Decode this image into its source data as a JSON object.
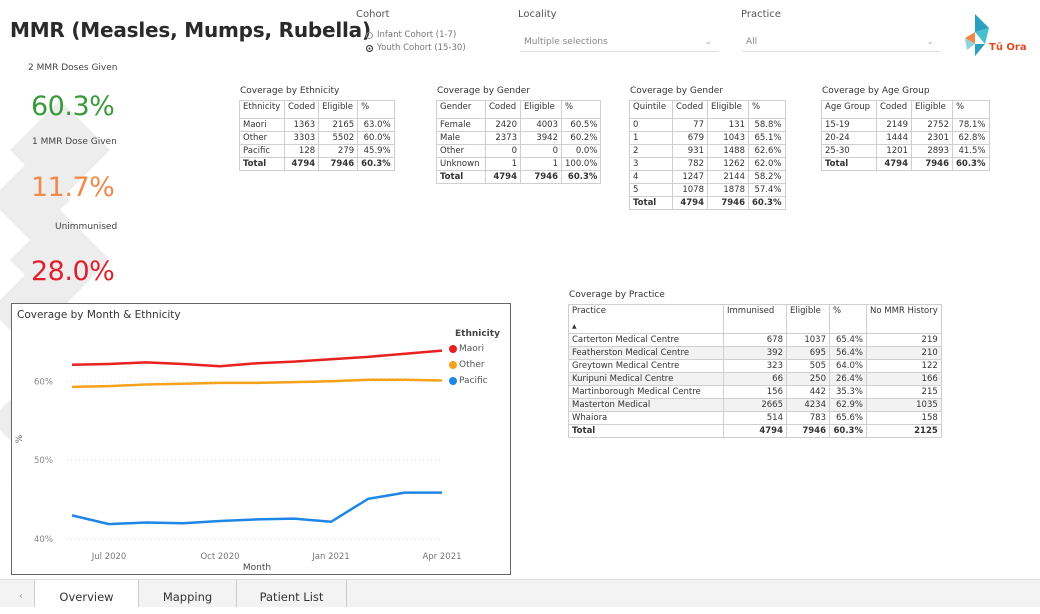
{
  "title": "MMR (Measles, Mumps, Rubella)",
  "kpis": [
    {
      "label": "2 MMR Doses Given",
      "value": "60.3%",
      "color": "#3a9a3a"
    },
    {
      "label": "1 MMR Dose Given",
      "value": "11.7%",
      "color": "#f08a4b"
    },
    {
      "label": "Unimmunised",
      "value": "28.0%",
      "color": "#e0202e"
    }
  ],
  "cohort": {
    "title": "Cohort",
    "options": [
      {
        "label": "Infant Cohort (1-7)",
        "selected": false
      },
      {
        "label": "Youth Cohort (15-30)",
        "selected": true
      }
    ]
  },
  "locality": {
    "title": "Locality",
    "value": "Multiple selections"
  },
  "practice": {
    "title": "Practice",
    "value": "All"
  },
  "logo": {
    "text": "Tū Ora",
    "icon": "tu-ora-logo-icon"
  },
  "ethnicity_table": {
    "title": "Coverage by Ethnicity",
    "headers": [
      "Ethnicity",
      "Coded",
      "Eligible",
      "%"
    ],
    "rows": [
      [
        "Maori",
        "1363",
        "2165",
        "63.0%"
      ],
      [
        "Other",
        "3303",
        "5502",
        "60.0%"
      ],
      [
        "Pacific",
        "128",
        "279",
        "45.9%"
      ]
    ],
    "total": [
      "Total",
      "4794",
      "7946",
      "60.3%"
    ]
  },
  "gender_table": {
    "title": "Coverage by Gender",
    "headers": [
      "Gender",
      "Coded",
      "Eligible",
      "%"
    ],
    "rows": [
      [
        "Female",
        "2420",
        "4003",
        "60.5%"
      ],
      [
        "Male",
        "2373",
        "3942",
        "60.2%"
      ],
      [
        "Other",
        "0",
        "0",
        "0.0%"
      ],
      [
        "Unknown",
        "1",
        "1",
        "100.0%"
      ]
    ],
    "total": [
      "Total",
      "4794",
      "7946",
      "60.3%"
    ]
  },
  "quintile_table": {
    "title": "Coverage by Gender",
    "headers": [
      "Quintile",
      "Coded",
      "Eligible",
      "%"
    ],
    "rows": [
      [
        "0",
        "77",
        "131",
        "58.8%"
      ],
      [
        "1",
        "679",
        "1043",
        "65.1%"
      ],
      [
        "2",
        "931",
        "1488",
        "62.6%"
      ],
      [
        "3",
        "782",
        "1262",
        "62.0%"
      ],
      [
        "4",
        "1247",
        "2144",
        "58.2%"
      ],
      [
        "5",
        "1078",
        "1878",
        "57.4%"
      ]
    ],
    "total": [
      "Total",
      "4794",
      "7946",
      "60.3%"
    ]
  },
  "age_table": {
    "title": "Coverage by Age Group",
    "headers": [
      "Age Group",
      "Coded",
      "Eligible",
      "%"
    ],
    "rows": [
      [
        "15-19",
        "2149",
        "2752",
        "78.1%"
      ],
      [
        "20-24",
        "1444",
        "2301",
        "62.8%"
      ],
      [
        "25-30",
        "1201",
        "2893",
        "41.5%"
      ]
    ],
    "total": [
      "Total",
      "4794",
      "7946",
      "60.3%"
    ]
  },
  "practice_table": {
    "title": "Coverage by Practice",
    "headers": [
      "Practice",
      "Immunised",
      "Eligible",
      "%",
      "No MMR History"
    ],
    "sort_indicator": "▲",
    "rows": [
      [
        "Carterton Medical Centre",
        "678",
        "1037",
        "65.4%",
        "219"
      ],
      [
        "Featherston Medical Centre",
        "392",
        "695",
        "56.4%",
        "210"
      ],
      [
        "Greytown Medical Centre",
        "323",
        "505",
        "64.0%",
        "122"
      ],
      [
        "Kuripuni Medical Centre",
        "66",
        "250",
        "26.4%",
        "166"
      ],
      [
        "Martinborough Medical Centre",
        "156",
        "442",
        "35.3%",
        "215"
      ],
      [
        "Masterton Medical",
        "2665",
        "4234",
        "62.9%",
        "1035"
      ],
      [
        "Whaiora",
        "514",
        "783",
        "65.6%",
        "158"
      ]
    ],
    "total": [
      "Total",
      "4794",
      "7946",
      "60.3%",
      "2125"
    ]
  },
  "chart_data": {
    "type": "line",
    "title": "Coverage by Month & Ethnicity",
    "xlabel": "Month",
    "ylabel": "%",
    "x": [
      "2020-06",
      "2020-07",
      "2020-08",
      "2020-09",
      "2020-10",
      "2020-11",
      "2020-12",
      "2021-01",
      "2021-02",
      "2021-03",
      "2021-04"
    ],
    "x_tick_labels": [
      {
        "x": "2020-07",
        "label": "Jul 2020"
      },
      {
        "x": "2020-10",
        "label": "Oct 2020"
      },
      {
        "x": "2021-01",
        "label": "Jan 2021"
      },
      {
        "x": "2021-04",
        "label": "Apr 2021"
      }
    ],
    "y_ticks": [
      {
        "v": 40,
        "label": "40%"
      },
      {
        "v": 50,
        "label": "50%"
      },
      {
        "v": 60,
        "label": "60%"
      }
    ],
    "ylim": [
      39,
      66
    ],
    "legend_title": "Ethnicity",
    "legend_position": "right",
    "series": [
      {
        "name": "Maori",
        "color": "#e8211f",
        "values": [
          62.1,
          62.2,
          62.4,
          62.2,
          61.9,
          62.3,
          62.5,
          62.8,
          63.1,
          63.5,
          63.9
        ]
      },
      {
        "name": "Other",
        "color": "#f7a21b",
        "values": [
          59.3,
          59.4,
          59.6,
          59.7,
          59.8,
          59.8,
          59.9,
          60.0,
          60.2,
          60.2,
          60.1
        ]
      },
      {
        "name": "Pacific",
        "color": "#1f86e6",
        "values": [
          43.0,
          41.9,
          42.1,
          42.0,
          42.3,
          42.5,
          42.6,
          42.2,
          45.1,
          45.9,
          45.9
        ]
      }
    ]
  },
  "tabs": [
    {
      "label": "Overview",
      "active": true
    },
    {
      "label": "Mapping",
      "active": false
    },
    {
      "label": "Patient List",
      "active": false
    }
  ],
  "tab_scroll_icon": "chevron-left-icon"
}
